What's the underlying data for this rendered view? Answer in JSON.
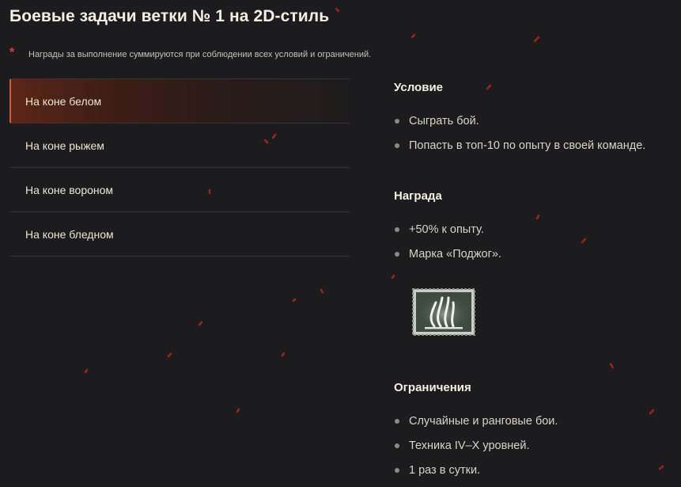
{
  "page": {
    "title": "Боевые задачи ветки № 1 на 2D-стиль",
    "note_marker": "*",
    "note": "Награды за выполнение суммируются при соблюдении всех условий и ограничений."
  },
  "tasks": [
    {
      "label": "На коне белом",
      "active": true
    },
    {
      "label": "На коне рыжем",
      "active": false
    },
    {
      "label": "На коне вороном",
      "active": false
    },
    {
      "label": "На коне бледном",
      "active": false
    }
  ],
  "details": {
    "condition": {
      "title": "Условие",
      "items": [
        "Сыграть бой.",
        "Попасть в топ-10 по опыту в своей команде."
      ]
    },
    "reward": {
      "title": "Награда",
      "items": [
        "+50% к опыту.",
        "Марка «Поджог»."
      ],
      "stamp_icon": "flame-stamp-icon"
    },
    "restrictions": {
      "title": "Ограничения",
      "items": [
        "Случайные и ранговые бои.",
        "Техника IV–X уровней.",
        "1 раз в сутки."
      ]
    }
  },
  "colors": {
    "background": "#1c1c1e",
    "accent": "#e2542d",
    "asterisk": "#e0412b",
    "divider": "#333336",
    "text": "#ece6d4"
  }
}
